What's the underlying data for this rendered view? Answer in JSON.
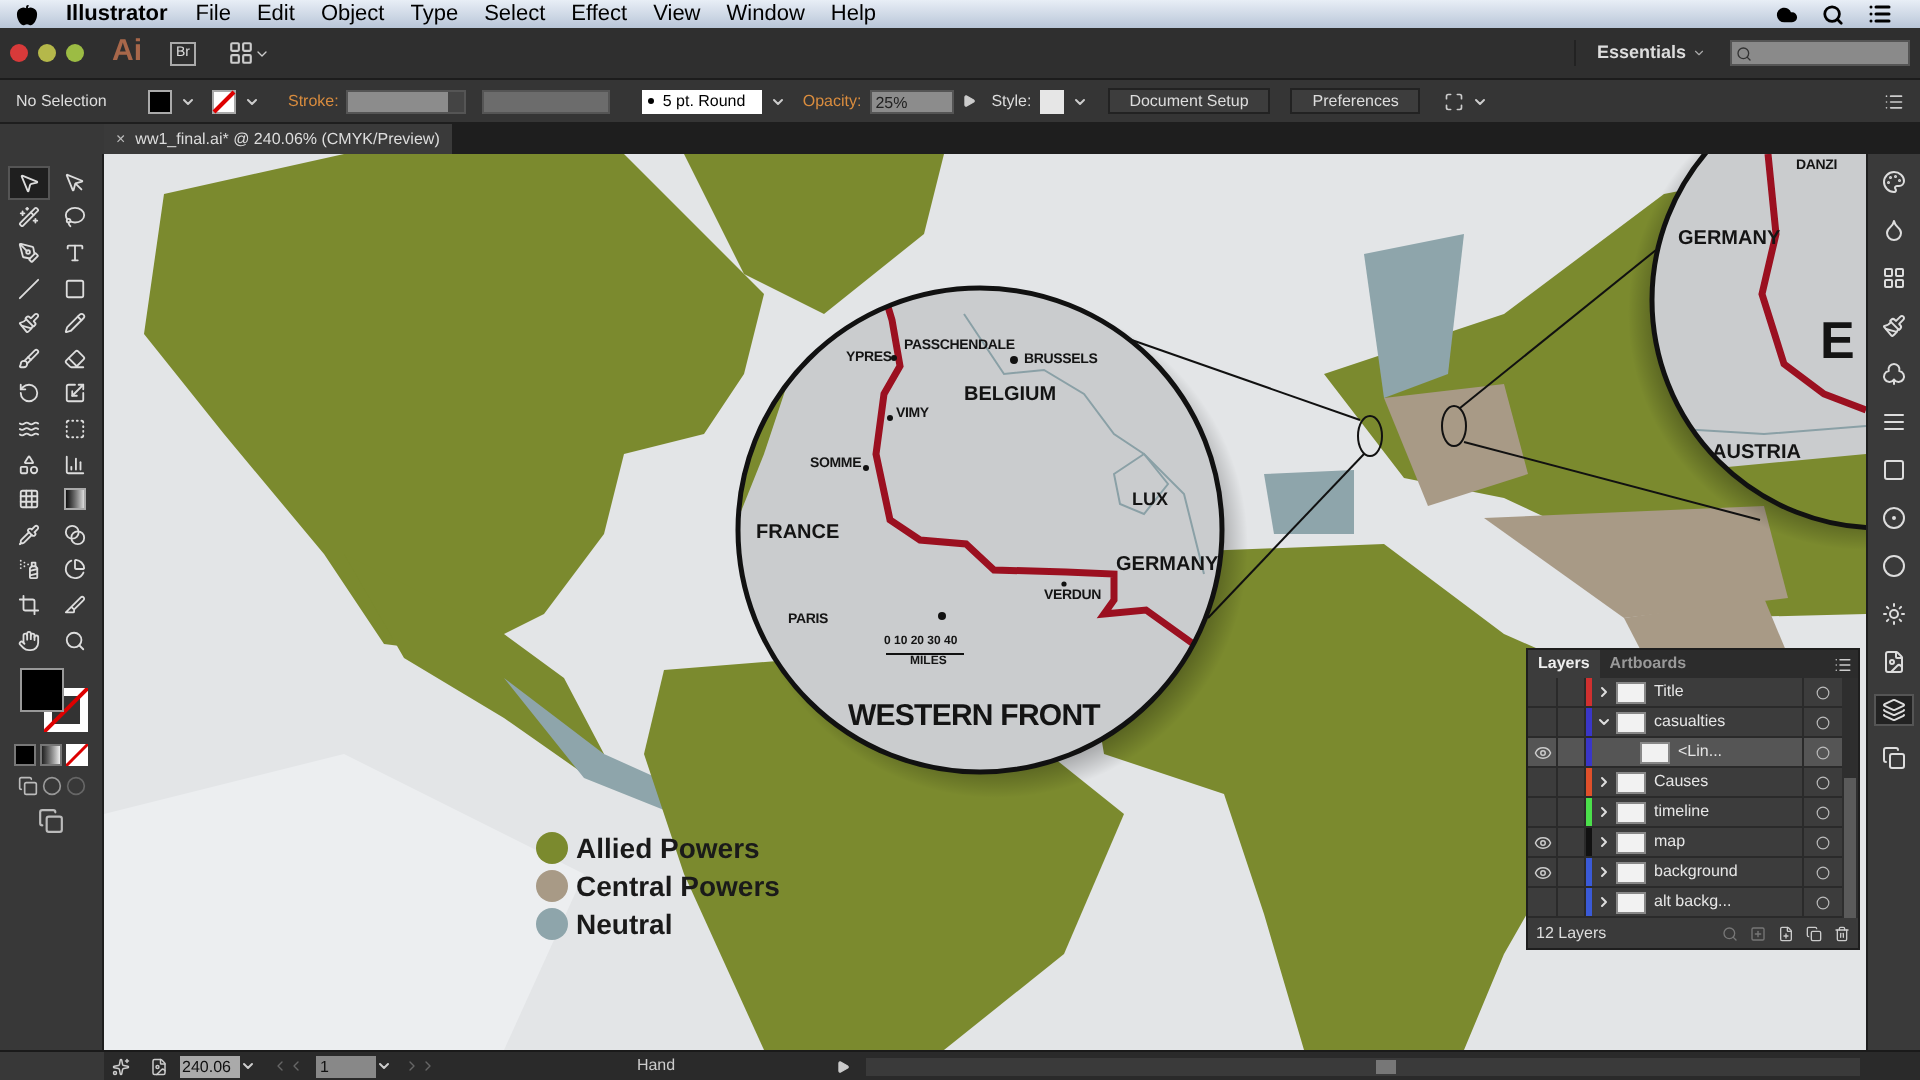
{
  "menu_bar": {
    "app_name": "Illustrator",
    "items": [
      "File",
      "Edit",
      "Object",
      "Type",
      "Select",
      "Effect",
      "View",
      "Window",
      "Help"
    ]
  },
  "app_bar": {
    "logo": "Ai",
    "bridge": "Br",
    "workspace": "Essentials"
  },
  "control_bar": {
    "selection": "No Selection",
    "stroke_label": "Stroke:",
    "brush": "5 pt. Round",
    "opacity_label": "Opacity:",
    "opacity": "25%",
    "style_label": "Style:",
    "buttons": [
      "Document Setup",
      "Preferences"
    ]
  },
  "document_tab": {
    "title": "ww1_final.ai* @ 240.06% (CMYK/Preview)",
    "close": "×"
  },
  "tools": [
    {
      "kind": "selection",
      "selected": true
    },
    {
      "kind": "direct-selection",
      "selected": false
    },
    {
      "kind": "magic-wand",
      "selected": false
    },
    {
      "kind": "lasso",
      "selected": false
    },
    {
      "kind": "pen",
      "selected": false
    },
    {
      "kind": "type",
      "selected": false
    },
    {
      "kind": "line",
      "selected": false
    },
    {
      "kind": "rectangle",
      "selected": false
    },
    {
      "kind": "paintbrush",
      "selected": false
    },
    {
      "kind": "pencil",
      "selected": false
    },
    {
      "kind": "blob-brush",
      "selected": false
    },
    {
      "kind": "eraser",
      "selected": false
    },
    {
      "kind": "rotate",
      "selected": false
    },
    {
      "kind": "scale",
      "selected": false
    },
    {
      "kind": "warp",
      "selected": false
    },
    {
      "kind": "free-transform",
      "selected": false
    },
    {
      "kind": "shape-builder",
      "selected": false
    },
    {
      "kind": "graph",
      "selected": false
    },
    {
      "kind": "mesh",
      "selected": false
    },
    {
      "kind": "gradient",
      "selected": false
    },
    {
      "kind": "eyedropper",
      "selected": false
    },
    {
      "kind": "blend",
      "selected": false
    },
    {
      "kind": "symbol-sprayer",
      "selected": false
    },
    {
      "kind": "pie",
      "selected": false
    },
    {
      "kind": "artboard",
      "selected": false
    },
    {
      "kind": "slice",
      "selected": false
    },
    {
      "kind": "hand",
      "selected": false
    },
    {
      "kind": "zoom",
      "selected": false
    }
  ],
  "map": {
    "labels": [
      {
        "text": "YPRES",
        "kind": "place"
      },
      {
        "text": "PASSCHENDALE",
        "kind": "place"
      },
      {
        "text": "BRUSSELS",
        "kind": "place"
      },
      {
        "text": "BELGIUM",
        "kind": "region"
      },
      {
        "text": "VIMY",
        "kind": "place"
      },
      {
        "text": "SOMME",
        "kind": "place"
      },
      {
        "text": "FRANCE",
        "kind": "region"
      },
      {
        "text": "LUX",
        "kind": "minor"
      },
      {
        "text": "GERMANY",
        "kind": "region"
      },
      {
        "text": "VERDUN",
        "kind": "place"
      },
      {
        "text": "PARIS",
        "kind": "place"
      },
      {
        "text": "0 10 20 30 40",
        "kind": "scale"
      },
      {
        "text": "MILES",
        "kind": "scale"
      },
      {
        "text": "WESTERN FRONT",
        "kind": "title"
      }
    ],
    "inset_labels": [
      {
        "text": "DANZI",
        "kind": "place"
      },
      {
        "text": "GERMANY",
        "kind": "region"
      },
      {
        "text": "E",
        "kind": "big"
      },
      {
        "text": "AUSTRIA",
        "kind": "region"
      }
    ],
    "legend": [
      {
        "label": "Allied Powers",
        "color": "#7b8a2e"
      },
      {
        "label": "Central Powers",
        "color": "#a89a86"
      },
      {
        "label": "Neutral",
        "color": "#8ea5ab"
      }
    ]
  },
  "layers_panel": {
    "tabs": [
      {
        "label": "Layers",
        "selected": true
      },
      {
        "label": "Artboards",
        "selected": false
      }
    ],
    "layers": [
      {
        "name": "Title",
        "color": "#d0302f",
        "visible": false,
        "expanded": false,
        "selected": false
      },
      {
        "name": "casualties",
        "color": "#3a36c8",
        "visible": false,
        "expanded": true,
        "selected": false,
        "children": [
          {
            "name": "<Lin...",
            "color": "#3a36c8",
            "visible": true,
            "selected": true
          }
        ]
      },
      {
        "name": "Causes",
        "color": "#e0502a",
        "visible": false,
        "expanded": false,
        "selected": false
      },
      {
        "name": "timeline",
        "color": "#4be04b",
        "visible": false,
        "expanded": false,
        "selected": false
      },
      {
        "name": "map",
        "color": "#111111",
        "visible": true,
        "expanded": false,
        "selected": false
      },
      {
        "name": "background",
        "color": "#3a5ad8",
        "visible": true,
        "expanded": false,
        "selected": false
      },
      {
        "name": "alt backg...",
        "color": "#3a5ad8",
        "visible": false,
        "expanded": false,
        "selected": false
      }
    ],
    "footer": "12 Layers"
  },
  "dock": [
    {
      "kind": "color",
      "selected": false
    },
    {
      "kind": "guide",
      "selected": false
    },
    {
      "kind": "swatches",
      "selected": false
    },
    {
      "kind": "brushes",
      "selected": false
    },
    {
      "kind": "symbols",
      "selected": false
    },
    {
      "kind": "stroke",
      "selected": false
    },
    {
      "kind": "gradient",
      "selected": false
    },
    {
      "kind": "transparency",
      "selected": false
    },
    {
      "kind": "appearance",
      "selected": false
    },
    {
      "kind": "styles",
      "selected": false
    },
    {
      "kind": "align",
      "selected": false
    },
    {
      "kind": "layers",
      "selected": true
    },
    {
      "kind": "artboards",
      "selected": false
    }
  ],
  "status_bar": {
    "zoom": "240.06",
    "page": "1",
    "tool": "Hand"
  }
}
